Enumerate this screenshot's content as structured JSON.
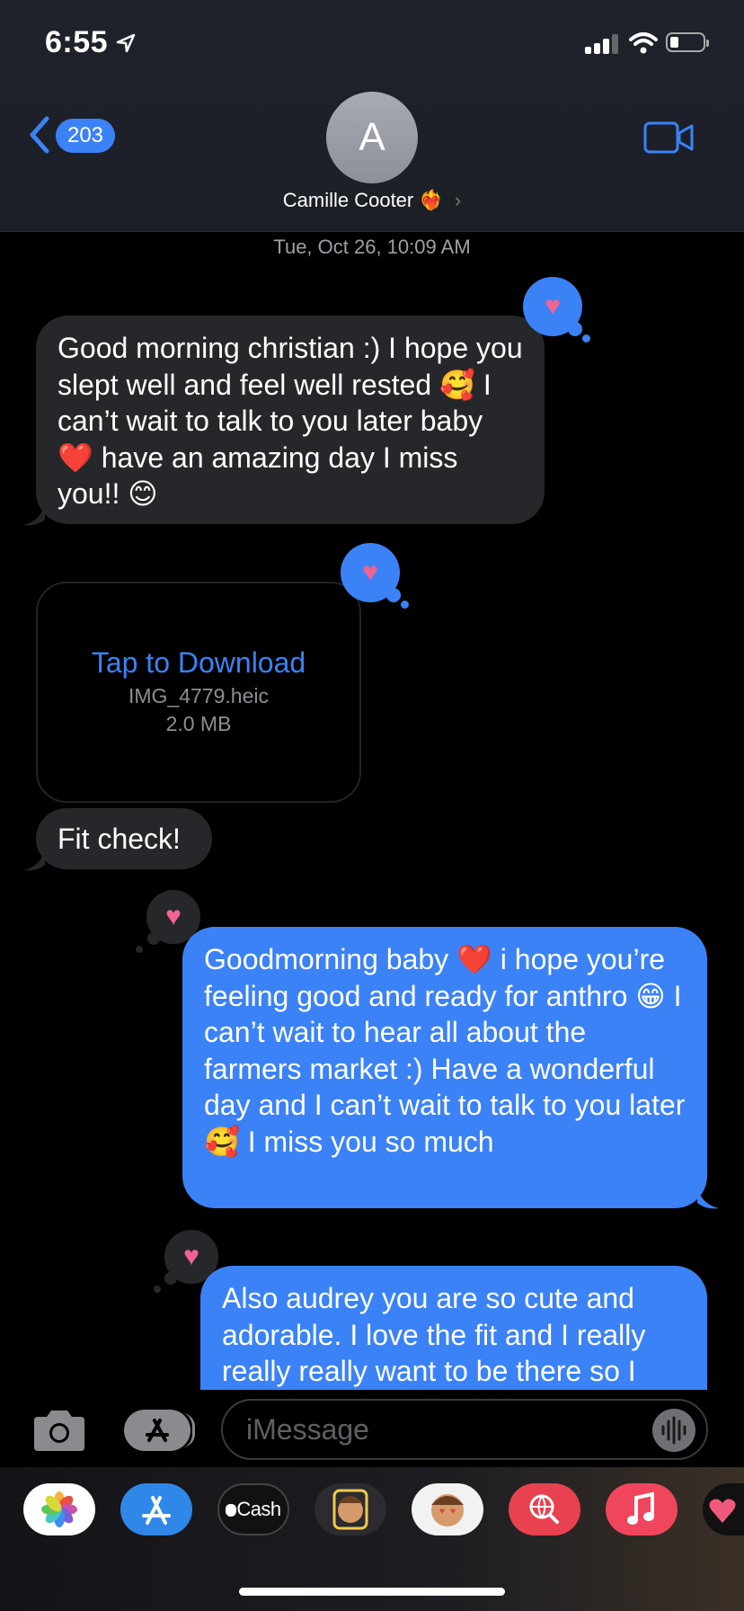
{
  "status_bar": {
    "time": "6:55"
  },
  "header": {
    "back_count": "203",
    "avatar_initial": "A",
    "contact_name": "Camille Cooter",
    "contact_emoji": "❤️‍🔥"
  },
  "conversation": {
    "timestamp": "Tue, Oct 26, 10:09 AM",
    "messages": [
      {
        "from": "them",
        "text": "Good morning christian :) I hope you slept well and feel well rested 🥰 I can’t wait to talk to you later baby ❤️ have an amazing day I miss you!! 😊",
        "reaction": "heart"
      },
      {
        "from": "them",
        "type": "attachment",
        "action": "Tap to Download",
        "filename": "IMG_4779.heic",
        "size": "2.0 MB",
        "reaction": "heart"
      },
      {
        "from": "them",
        "text": "Fit check!"
      },
      {
        "from": "me",
        "text": "Goodmorning baby ❤️ i hope you’re feeling good and ready for anthro 😁 I can’t wait to hear all about the farmers market :) Have a wonderful day and I can’t wait to talk to you later 🥰 I miss you so much",
        "reaction": "heart"
      },
      {
        "from": "me",
        "text": "Also audrey you are so cute and adorable. I love the fit and I really really really want to be there so I",
        "reaction": "heart"
      }
    ]
  },
  "composer": {
    "placeholder": "iMessage"
  },
  "app_drawer": [
    "photos-app",
    "app-store",
    "apple-cash",
    "memoji-1",
    "memoji-2",
    "search-images",
    "music",
    "digital-touch"
  ],
  "cash_label": "Cash",
  "colors": {
    "accent": "#3b82f6",
    "incoming_bubble": "#26272a",
    "heart": "#f06493"
  }
}
